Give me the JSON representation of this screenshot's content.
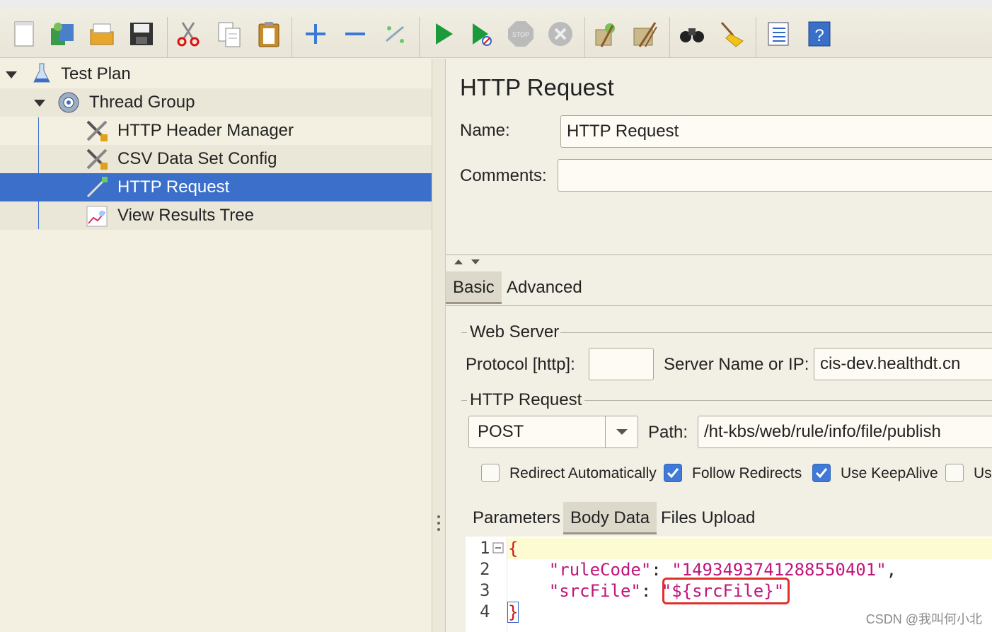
{
  "toolbar": {
    "icons": [
      "new-icon",
      "templates-icon",
      "open-icon",
      "save-icon",
      "cut-icon",
      "copy-icon",
      "paste-icon",
      "expand-icon",
      "collapse-icon",
      "toggle-icon",
      "start-icon",
      "start-no-pauses-icon",
      "stop-icon",
      "shutdown-icon",
      "clear-icon",
      "clear-all-icon",
      "search-icon",
      "reset-search-icon",
      "function-helper-icon",
      "help-icon"
    ],
    "stop_label": "STOP"
  },
  "tree": {
    "items": [
      {
        "label": "Test Plan",
        "icon": "flask-icon"
      },
      {
        "label": "Thread Group",
        "icon": "gear-icon"
      },
      {
        "label": "HTTP Header Manager",
        "icon": "tools-icon"
      },
      {
        "label": "CSV Data Set Config",
        "icon": "tools-icon"
      },
      {
        "label": "HTTP Request",
        "icon": "pipette-icon"
      },
      {
        "label": "View Results Tree",
        "icon": "chart-icon"
      }
    ]
  },
  "panel": {
    "title": "HTTP Request",
    "name_label": "Name:",
    "name_value": "HTTP Request",
    "comments_label": "Comments:",
    "comments_value": "",
    "tabs": [
      "Basic",
      "Advanced"
    ],
    "web_server_legend": "Web Server",
    "protocol_label": "Protocol [http]:",
    "protocol_value": "",
    "server_label": "Server Name or IP:",
    "server_value": "cis-dev.healthdt.cn",
    "http_request_legend": "HTTP Request",
    "method": "POST",
    "path_label": "Path:",
    "path_value": "/ht-kbs/web/rule/info/file/publish",
    "checkboxes": [
      {
        "label": "Redirect Automatically",
        "checked": false
      },
      {
        "label": "Follow Redirects",
        "checked": true
      },
      {
        "label": "Use KeepAlive",
        "checked": true
      },
      {
        "label": "Use",
        "checked": false
      }
    ],
    "body_tabs": [
      "Parameters",
      "Body Data",
      "Files Upload"
    ],
    "code": {
      "line_numbers": [
        "1",
        "2",
        "3",
        "4"
      ],
      "open_brace": "{",
      "key1": "\"ruleCode\"",
      "colon": ": ",
      "val1": "\"1493493741288550401\"",
      "comma": ",",
      "key2": "\"srcFile\"",
      "val2": "\"${srcFile}\"",
      "close_brace": "}"
    }
  },
  "watermark": "CSDN @我叫何小北"
}
